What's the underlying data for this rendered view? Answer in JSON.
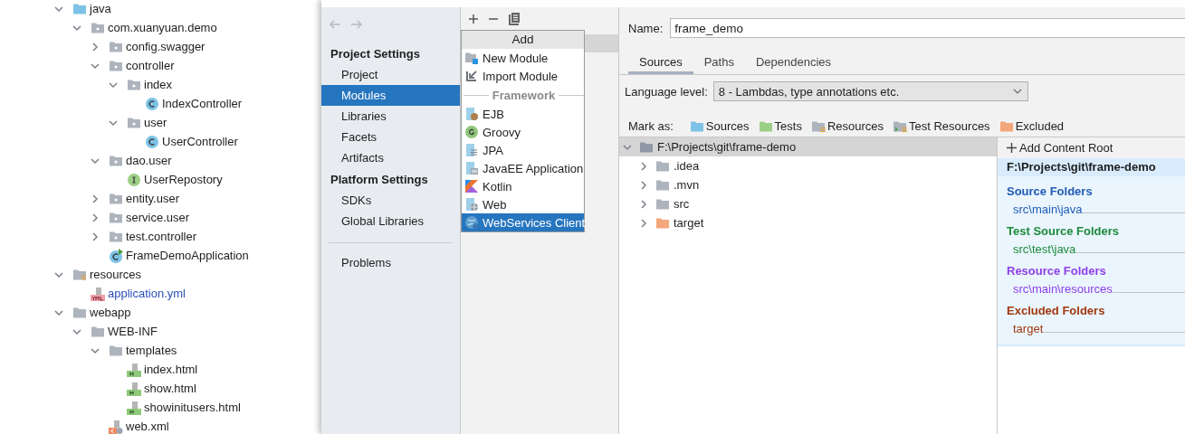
{
  "project_tree": [
    {
      "label": "java",
      "kind": "source-root",
      "expanded": true,
      "children": [
        {
          "label": "com.xuanyuan.demo",
          "kind": "package",
          "expanded": true,
          "children": [
            {
              "label": "config.swagger",
              "kind": "package",
              "expanded": false
            },
            {
              "label": "controller",
              "kind": "package",
              "expanded": true,
              "children": [
                {
                  "label": "index",
                  "kind": "package",
                  "expanded": true,
                  "children": [
                    {
                      "label": "IndexController",
                      "kind": "class"
                    }
                  ]
                },
                {
                  "label": "user",
                  "kind": "package",
                  "expanded": true,
                  "children": [
                    {
                      "label": "UserController",
                      "kind": "class"
                    }
                  ]
                }
              ]
            },
            {
              "label": "dao.user",
              "kind": "package",
              "expanded": true,
              "children": [
                {
                  "label": "UserRepostory",
                  "kind": "interface"
                }
              ]
            },
            {
              "label": "entity.user",
              "kind": "package",
              "expanded": false
            },
            {
              "label": "service.user",
              "kind": "package",
              "expanded": false
            },
            {
              "label": "test.controller",
              "kind": "package",
              "expanded": false
            },
            {
              "label": "FrameDemoApplication",
              "kind": "app-class"
            }
          ]
        }
      ]
    },
    {
      "label": "resources",
      "kind": "resource-root",
      "expanded": true,
      "children": [
        {
          "label": "application.yml",
          "kind": "yml",
          "color": "#2b4fb8"
        }
      ]
    },
    {
      "label": "webapp",
      "kind": "folder",
      "expanded": true,
      "children": [
        {
          "label": "WEB-INF",
          "kind": "folder",
          "expanded": true,
          "children": [
            {
              "label": "templates",
              "kind": "folder",
              "expanded": true,
              "children": [
                {
                  "label": "index.html",
                  "kind": "html"
                },
                {
                  "label": "show.html",
                  "kind": "html"
                },
                {
                  "label": "showinitusers.html",
                  "kind": "html"
                }
              ]
            },
            {
              "label": "web.xml",
              "kind": "xml"
            }
          ]
        }
      ]
    }
  ],
  "sidebar": [
    {
      "kind": "heading",
      "label": "Project Settings"
    },
    {
      "kind": "item",
      "label": "Project",
      "selected": false
    },
    {
      "kind": "item",
      "label": "Modules",
      "selected": true
    },
    {
      "kind": "item",
      "label": "Libraries",
      "selected": false
    },
    {
      "kind": "item",
      "label": "Facets",
      "selected": false
    },
    {
      "kind": "item",
      "label": "Artifacts",
      "selected": false
    },
    {
      "kind": "heading",
      "label": "Platform Settings"
    },
    {
      "kind": "item",
      "label": "SDKs",
      "selected": false
    },
    {
      "kind": "item",
      "label": "Global Libraries",
      "selected": false
    },
    {
      "kind": "divider"
    },
    {
      "kind": "item",
      "label": "Problems",
      "selected": false
    }
  ],
  "add_menu": {
    "title": "Add",
    "items": [
      {
        "kind": "new-module",
        "label": "New Module",
        "selected": false
      },
      {
        "kind": "import",
        "label": "Import Module",
        "selected": false
      },
      {
        "kind": "separator",
        "label": "Framework"
      },
      {
        "kind": "ejb",
        "label": "EJB",
        "selected": false
      },
      {
        "kind": "groovy",
        "label": "Groovy",
        "selected": false
      },
      {
        "kind": "jpa",
        "label": "JPA",
        "selected": false
      },
      {
        "kind": "javaee",
        "label": "JavaEE Application",
        "selected": false
      },
      {
        "kind": "kotlin",
        "label": "Kotlin",
        "selected": false
      },
      {
        "kind": "web",
        "label": "Web",
        "selected": false
      },
      {
        "kind": "webservices",
        "label": "WebServices Client",
        "selected": true
      }
    ]
  },
  "name_field": {
    "label": "Name:",
    "value": "frame_demo"
  },
  "tabs": [
    {
      "label": "Sources",
      "selected": true
    },
    {
      "label": "Paths",
      "selected": false
    },
    {
      "label": "Dependencies",
      "selected": false
    }
  ],
  "language_level": {
    "label": "Language level:",
    "value": "8 - Lambdas, type annotations etc."
  },
  "mark_as": {
    "label": "Mark as:",
    "options": [
      {
        "kind": "sources",
        "label": "Sources",
        "color": "#7ec3e6"
      },
      {
        "kind": "tests",
        "label": "Tests",
        "color": "#9ccf86"
      },
      {
        "kind": "resources",
        "label": "Resources",
        "color": "#adb4bd"
      },
      {
        "kind": "test-resources",
        "label": "Test Resources",
        "color": "#adb4bd"
      },
      {
        "kind": "excluded",
        "label": "Excluded",
        "color": "#f4a77b"
      }
    ]
  },
  "content_tree": {
    "label": "F:\\Projects\\git\\frame-demo",
    "expanded": true,
    "selected": true,
    "children": [
      {
        "label": ".idea",
        "expanded": false,
        "color": "#adb4bd"
      },
      {
        "label": ".mvn",
        "expanded": false,
        "color": "#adb4bd"
      },
      {
        "label": "src",
        "expanded": false,
        "color": "#adb4bd"
      },
      {
        "label": "target",
        "expanded": false,
        "color": "#f4a77b"
      }
    ]
  },
  "content_root": {
    "add_button": "Add Content Root",
    "path": "F:\\Projects\\git\\frame-demo",
    "groups": [
      {
        "title": "Source Folders",
        "color": "#1f5bb5",
        "folders": [
          "src\\main\\java"
        ]
      },
      {
        "title": "Test Source Folders",
        "color": "#1d8a3a",
        "folders": [
          "src\\test\\java"
        ]
      },
      {
        "title": "Resource Folders",
        "color": "#8d3ee8",
        "folders": [
          "src\\main\\resources"
        ]
      },
      {
        "title": "Excluded Folders",
        "color": "#a1380f",
        "folders": [
          "target"
        ]
      }
    ]
  }
}
